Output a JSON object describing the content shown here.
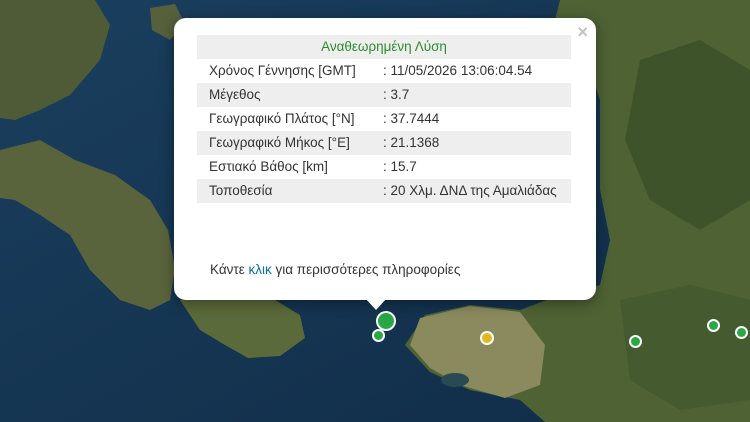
{
  "popup": {
    "title": "Αναθεωρημένη Λύση",
    "rows": [
      {
        "label": "Χρόνος Γέννησης [GMT]",
        "value": ": 11/05/2026 13:06:04.54"
      },
      {
        "label": "Μέγεθος",
        "value": ": 3.7"
      },
      {
        "label": "Γεωγραφικό Πλάτος [°N]",
        "value": ": 37.7444"
      },
      {
        "label": "Γεωγραφικό Μήκος [°E]",
        "value": ": 21.1368"
      },
      {
        "label": "Εστιακό Βάθος [km]",
        "value": ": 15.7"
      },
      {
        "label": "Τοποθεσία",
        "value": ": 20 Χλμ. ΔΝΔ της Αμαλιάδας"
      }
    ],
    "footer_pre": "Κάντε ",
    "footer_link": "κλικ",
    "footer_post": " για περισσότερες πληροφορίες",
    "close_symbol": "×"
  },
  "colors": {
    "marker_green": "#27a844",
    "marker_yellow": "#e3b81f",
    "title_green": "#2e8b2e",
    "link_blue": "#0a6ea8"
  }
}
